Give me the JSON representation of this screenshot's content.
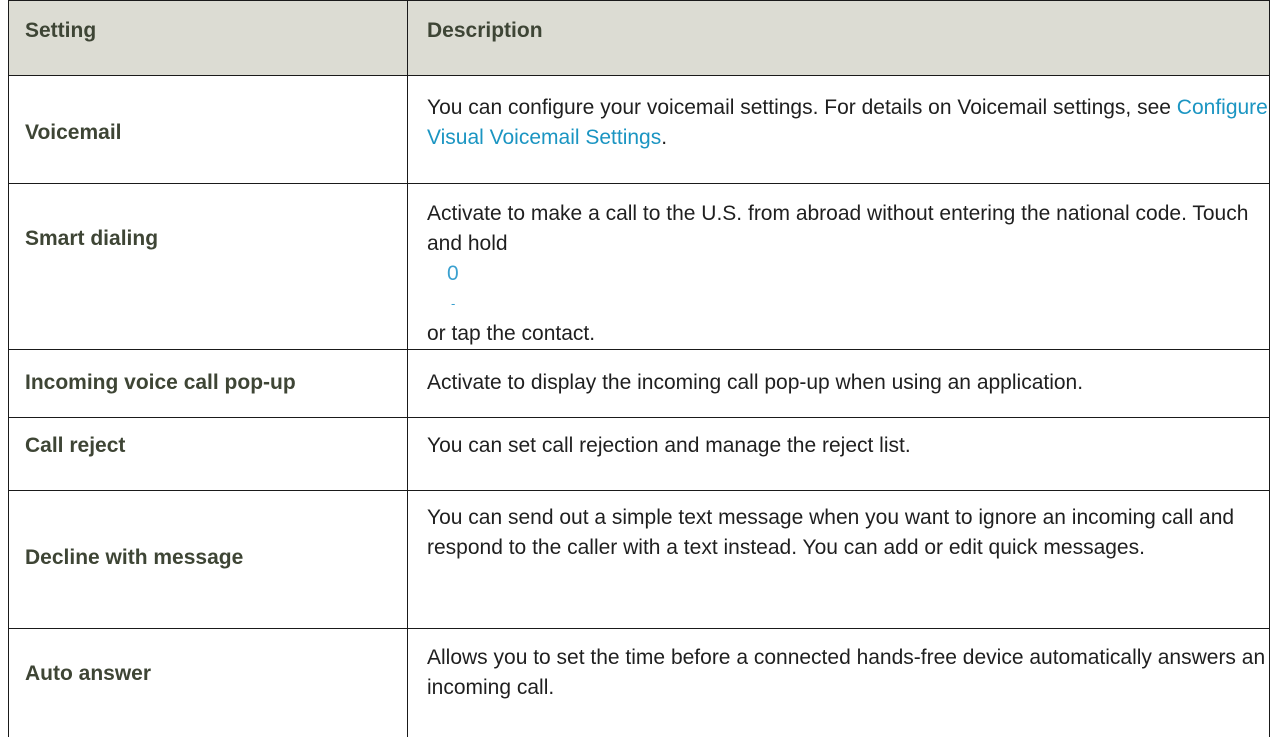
{
  "table": {
    "header": {
      "setting": "Setting",
      "description": "Description"
    },
    "rows": [
      {
        "setting": "Voicemail",
        "description_before": "You can configure your voicemail settings. For details on Voicemail settings, see ",
        "description_link": "Configure Visual Voicemail Settings",
        "description_after": "."
      },
      {
        "setting": "Smart dialing",
        "description_before": "Activate to make a call to the U.S. from abroad without entering the national code. Touch and hold",
        "key_label": "0",
        "key_sublabel": "-",
        "description_after": "or tap the contact."
      },
      {
        "setting": "Incoming voice call pop-up",
        "description": "Activate to display the incoming call pop-up when using an application."
      },
      {
        "setting": "Call reject",
        "description": "You can set call rejection and manage the reject list."
      },
      {
        "setting": "Decline with message",
        "description": "You can send out a simple text message when you want to ignore an incoming call and respond to the caller with a text instead. You can add or edit quick messages."
      },
      {
        "setting": "Auto answer",
        "description": "Allows you to set the time before a connected hands-free device automatically answers an incoming call."
      }
    ]
  },
  "colors": {
    "header_bg": "#dcdcd3",
    "setting_text": "#3e4535",
    "link": "#1b95c2",
    "border": "#1a1a1a"
  }
}
